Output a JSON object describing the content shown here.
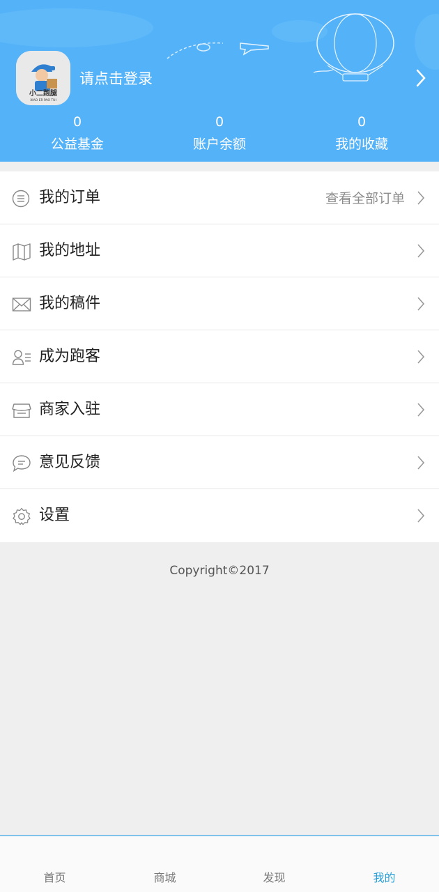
{
  "header": {
    "login_text": "请点击登录",
    "avatar_icon": "xiaoer-paotui-logo",
    "logo_text_main": "小二跑腿",
    "logo_text_sub": "XIAO ER PAO TUI",
    "stats": [
      {
        "value": "0",
        "label": "公益基金"
      },
      {
        "value": "0",
        "label": "账户余额"
      },
      {
        "value": "0",
        "label": "我的收藏"
      }
    ],
    "background_color": "#54b2f8"
  },
  "menu": {
    "items": [
      {
        "label": "我的订单",
        "extra": "查看全部订单",
        "icon": "order-list-icon"
      },
      {
        "label": "我的地址",
        "extra": "",
        "icon": "map-icon"
      },
      {
        "label": "我的稿件",
        "extra": "",
        "icon": "envelope-icon"
      },
      {
        "label": "成为跑客",
        "extra": "",
        "icon": "user-card-icon"
      },
      {
        "label": "商家入驻",
        "extra": "",
        "icon": "store-icon"
      },
      {
        "label": "意见反馈",
        "extra": "",
        "icon": "chat-bubble-icon"
      },
      {
        "label": "设置",
        "extra": "",
        "icon": "gear-icon"
      }
    ]
  },
  "footer": {
    "copyright": "Copyright©2017"
  },
  "tabbar": {
    "tabs": [
      {
        "label": "首页",
        "active": false
      },
      {
        "label": "商城",
        "active": false
      },
      {
        "label": "发现",
        "active": false
      },
      {
        "label": "我的",
        "active": true
      }
    ],
    "active_color": "#2a9fd8"
  }
}
